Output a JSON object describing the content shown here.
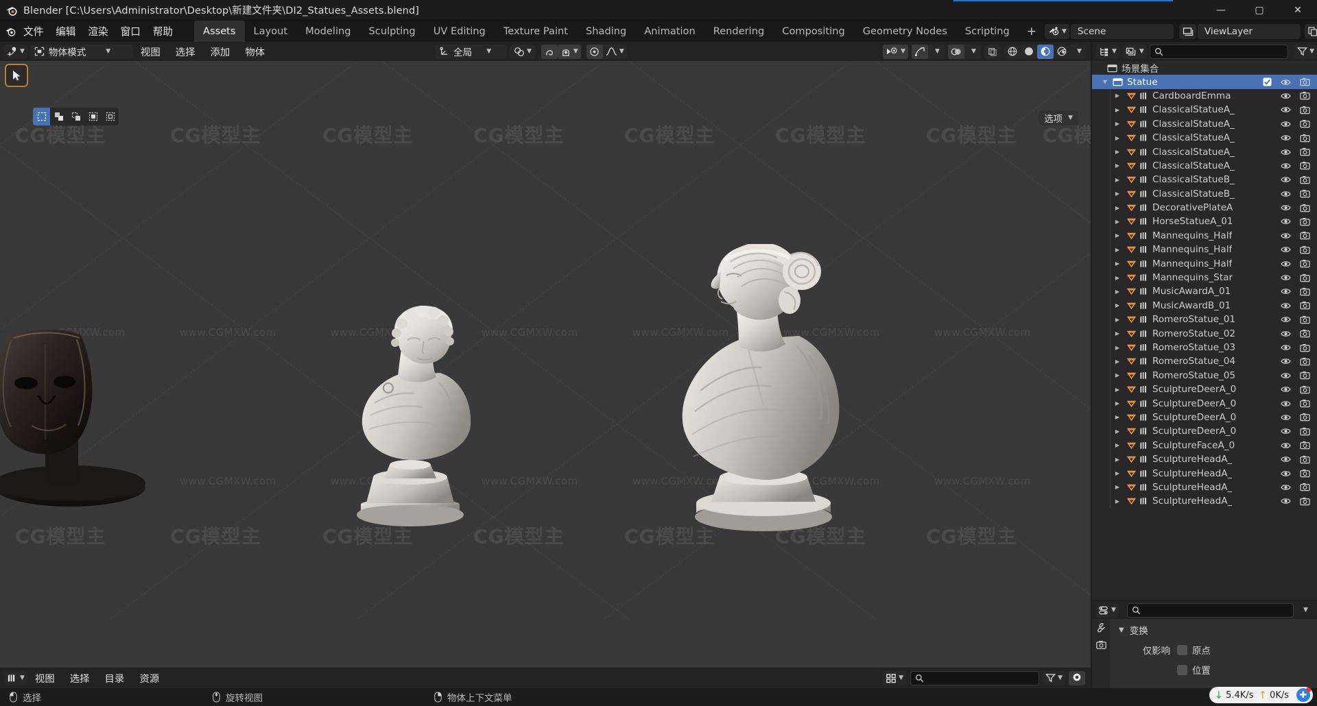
{
  "window": {
    "title": "Blender [C:\\Users\\Administrator\\Desktop\\新建文件夹\\DI2_Statues_Assets.blend]",
    "minimize": "—",
    "maximize": "▢",
    "close": "✕"
  },
  "topbar": {
    "menus": [
      "文件",
      "编辑",
      "渲染",
      "窗口",
      "帮助"
    ],
    "tabs": [
      {
        "label": "Assets",
        "active": true
      },
      {
        "label": "Layout",
        "active": false
      },
      {
        "label": "Modeling",
        "active": false
      },
      {
        "label": "Sculpting",
        "active": false
      },
      {
        "label": "UV Editing",
        "active": false
      },
      {
        "label": "Texture Paint",
        "active": false
      },
      {
        "label": "Shading",
        "active": false
      },
      {
        "label": "Animation",
        "active": false
      },
      {
        "label": "Rendering",
        "active": false
      },
      {
        "label": "Compositing",
        "active": false
      },
      {
        "label": "Geometry Nodes",
        "active": false
      },
      {
        "label": "Scripting",
        "active": false
      }
    ],
    "add_tab": "+",
    "scene_name": "Scene",
    "viewlayer_name": "ViewLayer"
  },
  "viewport": {
    "mode": "物体模式",
    "menus": [
      "视图",
      "选择",
      "添加",
      "物体"
    ],
    "transform_orientation": "全局",
    "gizmo_options": "选项",
    "editor_type_icon": "editor-type-icon"
  },
  "asset_browser": {
    "menus": [
      "视图",
      "选择",
      "目录",
      "资源"
    ],
    "search_placeholder": ""
  },
  "statusbar": {
    "items": [
      {
        "icon": "mouse-left-icon",
        "label": "选择"
      },
      {
        "icon": "mouse-middle-icon",
        "label": "旋转视图"
      },
      {
        "icon": "mouse-right-icon",
        "label": "物体上下文菜单"
      }
    ]
  },
  "outliner": {
    "search_placeholder": "",
    "root": "场景集合",
    "collection": {
      "name": "Statue",
      "selected": true
    },
    "items": [
      "CardboardEmma",
      "ClassicalStatueA_",
      "ClassicalStatueA_",
      "ClassicalStatueA_",
      "ClassicalStatueA_",
      "ClassicalStatueA_",
      "ClassicalStatueB_",
      "ClassicalStatueB_",
      "DecorativePlateA",
      "HorseStatueA_01",
      "Mannequins_Half",
      "Mannequins_Half",
      "Mannequins_Half",
      "Mannequins_Star",
      "MusicAwardA_01",
      "MusicAwardB_01",
      "RomeroStatue_01",
      "RomeroStatue_02",
      "RomeroStatue_03",
      "RomeroStatue_04",
      "RomeroStatue_05",
      "SculptureDeerA_0",
      "SculptureDeerA_0",
      "SculptureDeerA_0",
      "SculptureDeerA_0",
      "SculptureFaceA_0",
      "SculptureHeadA_",
      "SculptureHeadA_",
      "SculptureHeadA_",
      "SculptureHeadA_"
    ]
  },
  "properties": {
    "search_placeholder": "",
    "panel_title": "变换",
    "rows": [
      {
        "label": "仅影响",
        "value": "原点"
      },
      {
        "label": "",
        "value": "位置"
      }
    ]
  },
  "network": {
    "down": "5.4K/s",
    "up": "0K/s"
  },
  "watermark": {
    "brand": "CG模型主",
    "url": "www.CGMXW.com"
  },
  "colors": {
    "accent_blue": "#4772b3",
    "orange": "#e8842a",
    "viewport_bg": "#393939",
    "panel_bg": "#282828",
    "header_bg": "#232323"
  }
}
